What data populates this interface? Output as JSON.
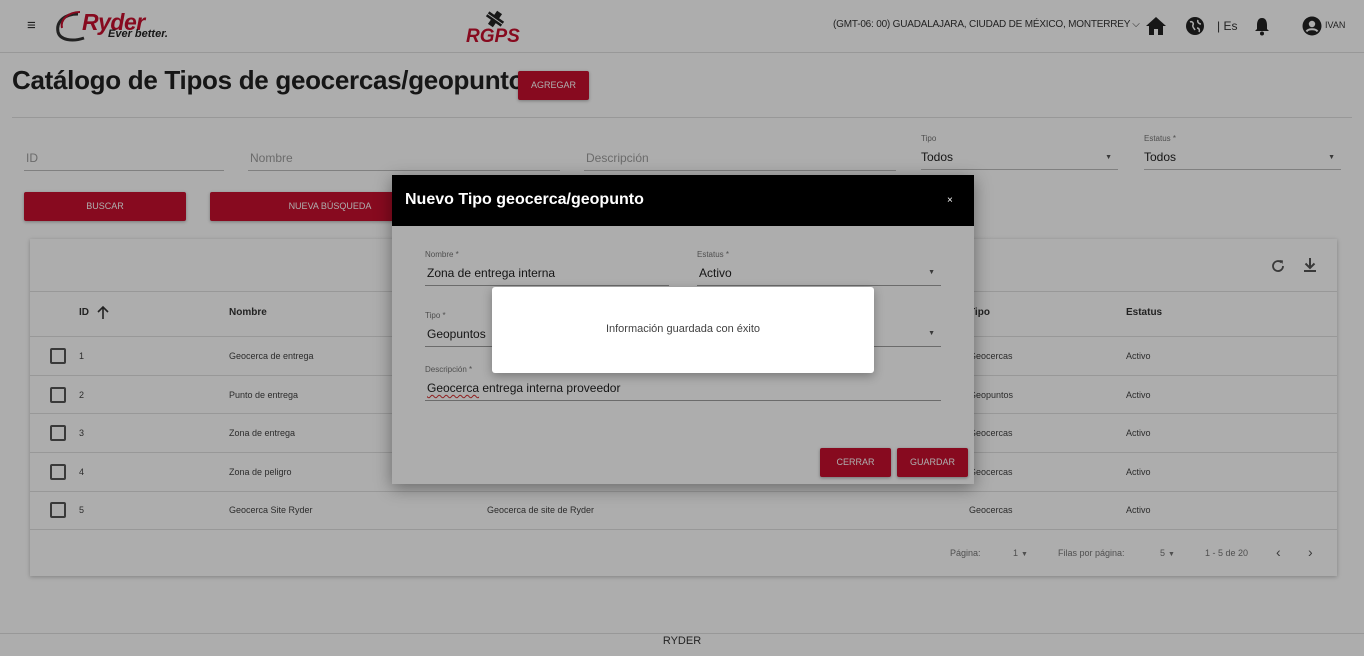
{
  "header": {
    "brand": "Ryder",
    "tagline": "Ever better.",
    "product": "RGPS",
    "timezone": "(GMT-06: 00) GUADALAJARA, CIUDAD DE MÉXICO, MONTERREY",
    "language": "| Es",
    "username": "IVAN",
    "icons": [
      "menu-icon",
      "home-icon",
      "globe-icon",
      "bell-icon",
      "account-icon"
    ]
  },
  "page": {
    "title": "Catálogo de Tipos de geocercas/geopuntos",
    "add_label": "AGREGAR"
  },
  "filters": {
    "id_placeholder": "ID",
    "nombre_placeholder": "Nombre",
    "descripcion_placeholder": "Descripción",
    "tipo_label": "Tipo",
    "tipo_value": "Todos",
    "estatus_label": "Estatus *",
    "estatus_value": "Todos",
    "search_label": "BUSCAR",
    "new_search_label": "NUEVA BÚSQUEDA"
  },
  "table": {
    "columns": {
      "id": "ID",
      "nombre": "Nombre",
      "tipo": "Tipo",
      "estatus": "Estatus"
    },
    "rows": [
      {
        "id": "1",
        "nombre": "Geocerca de entrega",
        "descripcion": "",
        "tipo": "Geocercas",
        "estatus": "Activo"
      },
      {
        "id": "2",
        "nombre": "Punto de entrega",
        "descripcion": "",
        "tipo": "Geopuntos",
        "estatus": "Activo"
      },
      {
        "id": "3",
        "nombre": "Zona de entrega",
        "descripcion": "",
        "tipo": "Geocercas",
        "estatus": "Activo"
      },
      {
        "id": "4",
        "nombre": "Zona de peligro",
        "descripcion": "",
        "tipo": "Geocercas",
        "estatus": "Activo"
      },
      {
        "id": "5",
        "nombre": "Geocerca Site Ryder",
        "descripcion": "Geocerca de site de Ryder",
        "tipo": "Geocercas",
        "estatus": "Activo"
      }
    ],
    "pagination": {
      "page_label": "Página:",
      "page_value": "1",
      "rows_label": "Filas por página:",
      "rows_value": "5",
      "range": "1 - 5 de 20"
    }
  },
  "footer": {
    "text": "RYDER"
  },
  "dialog": {
    "title": "Nuevo Tipo geocerca/geopunto",
    "close": "×",
    "nombre_label": "Nombre *",
    "nombre_value": "Zona de entrega interna",
    "estatus_label": "Estatus *",
    "estatus_value": "Activo",
    "tipo_label": "Tipo *",
    "tipo_value": "Geopuntos",
    "descripcion_label": "Descripción *",
    "descripcion_word1": "Geocerca",
    "descripcion_rest": " entrega interna proveedor",
    "cerrar_label": "CERRAR",
    "guardar_label": "GUARDAR"
  },
  "toast": {
    "message": "Información guardada con éxito"
  },
  "colors": {
    "accent": "#c8102e",
    "dialog_header": "#000000"
  }
}
